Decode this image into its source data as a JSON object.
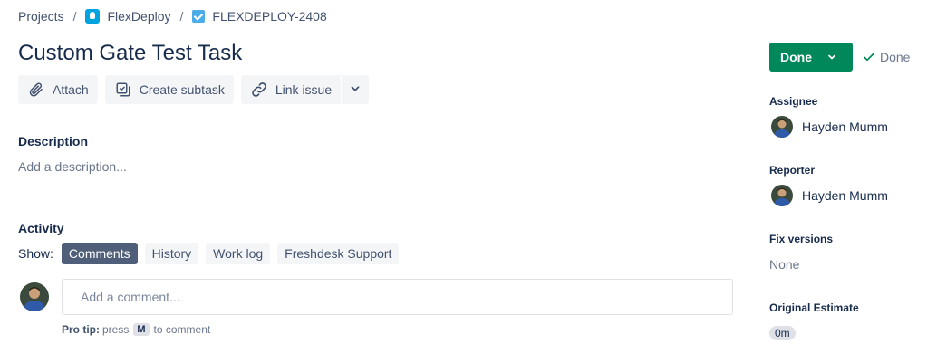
{
  "breadcrumb": {
    "projects": "Projects",
    "separator": "/",
    "project": "FlexDeploy",
    "issue_key": "FLEXDEPLOY-2408"
  },
  "issue": {
    "title": "Custom Gate Test Task"
  },
  "toolbar": {
    "attach": "Attach",
    "create_subtask": "Create subtask",
    "link_issue": "Link issue"
  },
  "description": {
    "label": "Description",
    "placeholder": "Add a description..."
  },
  "activity": {
    "label": "Activity",
    "show_label": "Show:",
    "tabs": [
      {
        "label": "Comments",
        "active": true
      },
      {
        "label": "History",
        "active": false
      },
      {
        "label": "Work log",
        "active": false
      },
      {
        "label": "Freshdesk Support",
        "active": false
      }
    ],
    "comment_placeholder": "Add a comment...",
    "protip_label": "Pro tip:",
    "protip_press": "press",
    "protip_key": "M",
    "protip_suffix": "to comment"
  },
  "sidebar": {
    "status_button": "Done",
    "status_resolution": "Done",
    "assignee_label": "Assignee",
    "assignee": "Hayden Mumm",
    "reporter_label": "Reporter",
    "reporter": "Hayden Mumm",
    "fix_versions_label": "Fix versions",
    "fix_versions": "None",
    "original_estimate_label": "Original Estimate",
    "original_estimate": "0m"
  },
  "colors": {
    "status_green": "#00875a",
    "active_chip": "#505f79",
    "project_icon": "#00a3e0",
    "task_icon": "#4bade8"
  }
}
